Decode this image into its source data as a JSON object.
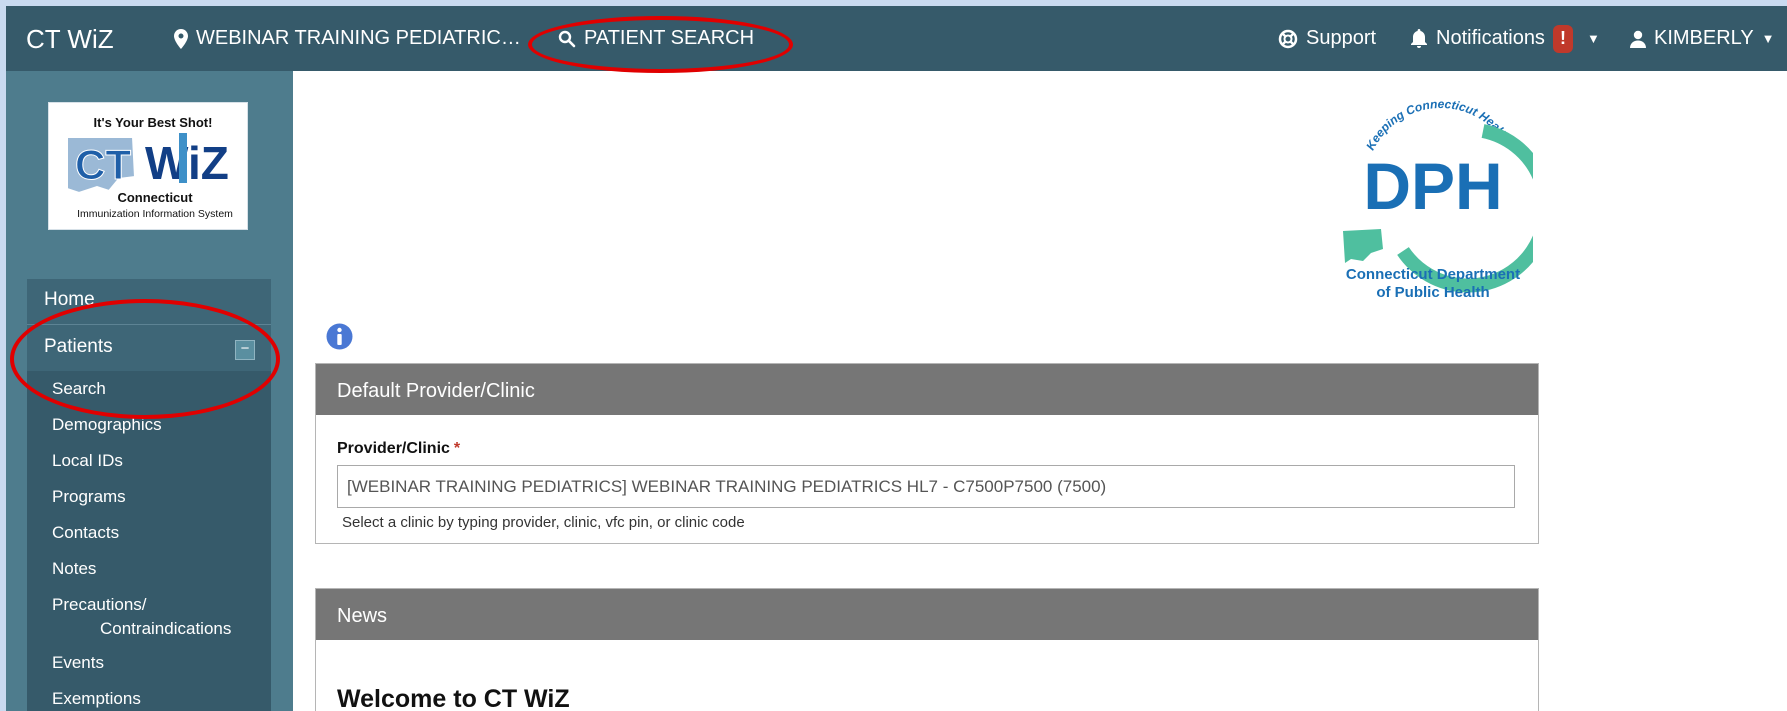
{
  "topbar": {
    "brand": "CT WiZ",
    "clinic": "WEBINAR TRAINING PEDIATRIC…",
    "patient_search": "PATIENT SEARCH",
    "support": "Support",
    "notifications": "Notifications",
    "notification_badge": "!",
    "user": "KIMBERLY"
  },
  "sidebar": {
    "logo": {
      "tagline": "It's Your Best Shot!",
      "name": "CT WiZ",
      "state": "Connecticut",
      "subtitle": "Immunization Information System"
    },
    "home": "Home",
    "patients": "Patients",
    "collapse_symbol": "−",
    "items": [
      {
        "label": "Search"
      },
      {
        "label": "Demographics"
      },
      {
        "label": "Local IDs"
      },
      {
        "label": "Programs"
      },
      {
        "label": "Contacts"
      },
      {
        "label": "Notes"
      },
      {
        "label": "Precautions/",
        "label2": "Contraindications"
      },
      {
        "label": "Events"
      },
      {
        "label": "Exemptions"
      }
    ]
  },
  "dph_logo": {
    "arc_text": "Keeping Connecticut Healthy",
    "letters": "DPH",
    "line1": "Connecticut Department",
    "line2": "of Public Health"
  },
  "default_panel": {
    "title": "Default Provider/Clinic",
    "field_label": "Provider/Clinic",
    "required_mark": "*",
    "value": "[WEBINAR TRAINING PEDIATRICS] WEBINAR TRAINING PEDIATRICS HL7 - C7500P7500 (7500)",
    "help": "Select a clinic by typing provider, clinic, vfc pin, or clinic code"
  },
  "news_panel": {
    "title": "News",
    "welcome": "Welcome to CT WiZ"
  },
  "colors": {
    "topbar": "#365a6a",
    "sidebar": "#4e7c8d",
    "panel_header": "#767676",
    "annotation": "#e00000",
    "dph_blue": "#1a6fb5",
    "dph_green": "#4fbf9f"
  }
}
